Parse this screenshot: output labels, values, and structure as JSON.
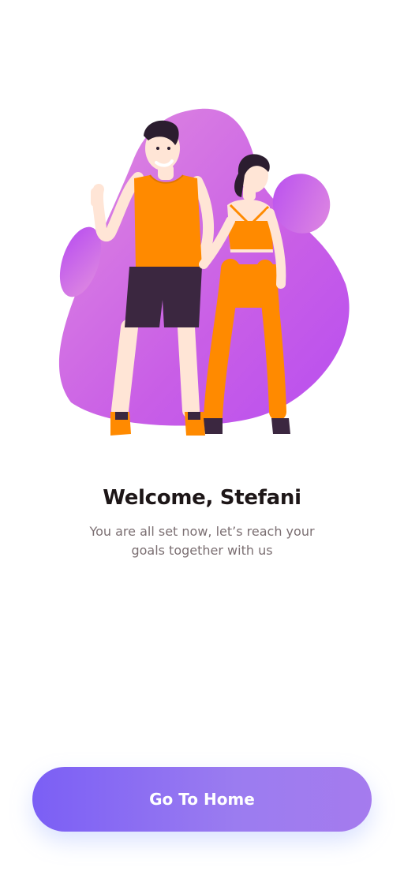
{
  "welcome": {
    "title": "Welcome, Stefani",
    "subtitle": "You are all set now, let’s reach your goals together with us"
  },
  "actions": {
    "primary_label": "Go To Home"
  },
  "colors": {
    "accent_start": "#7b5ff5",
    "accent_end": "#a57bee",
    "blob_purple": "#c45ce6",
    "outfit_orange": "#ff8a00"
  },
  "illustration": {
    "icon": "couple-fitness-illustration"
  }
}
